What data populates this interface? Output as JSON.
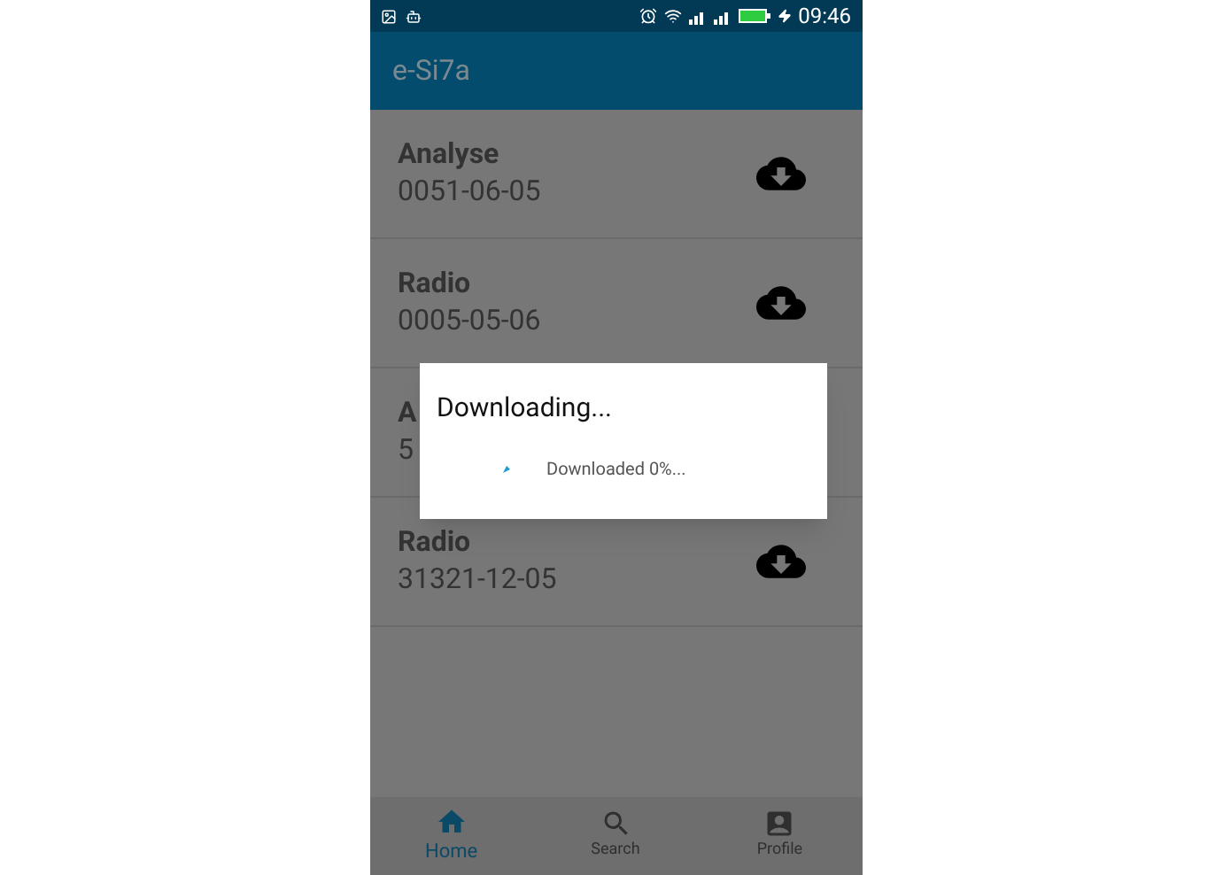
{
  "status_bar": {
    "time": "09:46"
  },
  "app_bar": {
    "title": "e-Si7a"
  },
  "items": [
    {
      "title": "Analyse",
      "date": "0051-06-05",
      "download_icon": true
    },
    {
      "title": "Radio",
      "date": "0005-05-06",
      "download_icon": true
    },
    {
      "title": "A",
      "date": "5"
    },
    {
      "title": "Radio",
      "date": "31321-12-05",
      "download_icon": true
    }
  ],
  "dialog": {
    "title": "Downloading...",
    "message": "Downloaded 0%..."
  },
  "bottom_nav": [
    {
      "label": "Home",
      "kind": "home",
      "selected": true
    },
    {
      "label": "Search",
      "kind": "search",
      "selected": false
    },
    {
      "label": "Profile",
      "kind": "profile",
      "selected": false
    }
  ]
}
